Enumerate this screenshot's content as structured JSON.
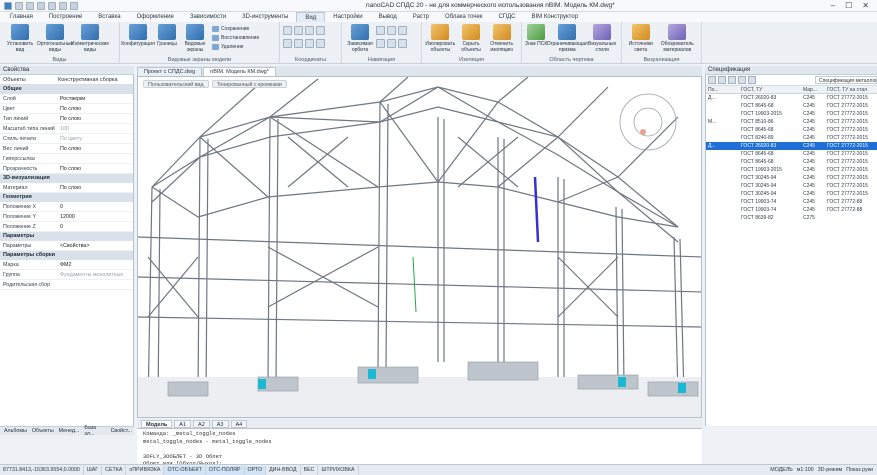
{
  "title": {
    "app": "nanoCAD СПДС 20 - не для коммерческого использования nBIM. Модель КМ.dwg*"
  },
  "tabs": [
    "Главная",
    "Построение",
    "Вставка",
    "Оформление",
    "Зависимости",
    "3D-инструменты",
    "Вид",
    "Настройки",
    "Вывод",
    "Растр",
    "Облака точек",
    "СПДС",
    "BIM Конструктор"
  ],
  "active_tab": "Вид",
  "ribbon": {
    "views": {
      "label": "Виды",
      "b1": "Установить вид",
      "b2": "Ортогональные виды",
      "b3": "Изометрические виды"
    },
    "screens": {
      "label": "Видовые экраны модели",
      "b1": "Конфигурация",
      "b2": "Границы",
      "b3": "Видовые экраны",
      "s1": "Сохранение",
      "s2": "Восстановление",
      "s3": "Удаление"
    },
    "coords": {
      "label": "Координаты"
    },
    "nav": {
      "label": "Навигация",
      "b1": "Зависимая орбита"
    },
    "iso": {
      "label": "Изоляция",
      "b1": "Изолировать объекты",
      "b2": "Скрыть объекты",
      "b3": "Отменить изоляцию"
    },
    "area": {
      "label": "Область чертежа",
      "b1": "Знак ПСК",
      "b2": "Ограничивающая призма",
      "b3": "Визуальные стили"
    },
    "vis": {
      "label": "Визуализация",
      "b1": "Источники света",
      "b2": "Обозреватель материалов"
    }
  },
  "props": {
    "title": "Свойства",
    "top_k": "Объекты",
    "top_v": "Конструктивная сборка",
    "sections": [
      {
        "name": "Общие",
        "rows": [
          [
            "Слой",
            "Ростверки",
            false
          ],
          [
            "Цвет",
            "По слою",
            false
          ],
          [
            "Тип линий",
            "По слою",
            false
          ],
          [
            "Масштаб типа линий",
            "100",
            true
          ],
          [
            "Стиль печати",
            "По цвету",
            true
          ],
          [
            "Вес линий",
            "По слою",
            false
          ],
          [
            "Гиперссылка",
            "",
            false
          ],
          [
            "Прозрачность",
            "По слою",
            false
          ]
        ]
      },
      {
        "name": "3D-визуализация",
        "rows": [
          [
            "Материал",
            "По слою",
            false
          ]
        ]
      },
      {
        "name": "Геометрия",
        "rows": [
          [
            "Положение X",
            "0",
            false
          ],
          [
            "Положение Y",
            "12000",
            false
          ],
          [
            "Положение Z",
            "0",
            false
          ]
        ]
      },
      {
        "name": "Параметры",
        "rows": [
          [
            "Параметры",
            "<Свойства>",
            false
          ]
        ]
      },
      {
        "name": "Параметры сборки",
        "rows": [
          [
            "Марка",
            "ФМ2",
            false
          ],
          [
            "Группа",
            "Фундаменты монолитные",
            true
          ],
          [
            "Родительская сбор",
            "",
            false
          ]
        ]
      }
    ]
  },
  "doc_tabs": [
    "Проект с СПДС.dwg",
    "nBIM. Модель КМ.dwg*"
  ],
  "view_tabs": [
    "Пользовательский вид",
    "Тонированный с кромками"
  ],
  "layout_tabs": [
    "Модель",
    "A1",
    "A2",
    "A3",
    "A4"
  ],
  "spec": {
    "title": "Спецификация",
    "dropdown": "Спецификация металлопроката",
    "headers": [
      "По...",
      "ГОСТ, ТУ",
      "Мар...",
      "ГОСТ, ТУ на стал"
    ],
    "rows": [
      [
        "Д...",
        "ГОСТ 26020-83",
        "С245",
        "ГОСТ 27772-2015",
        false
      ],
      [
        "",
        "ГОСТ 8645-68",
        "С245",
        "ГОСТ 27772-2015",
        false
      ],
      [
        "",
        "ГОСТ 19903-2015",
        "С245",
        "ГОСТ 27772-2015",
        false
      ],
      [
        "М...",
        "ГОСТ 8510-86",
        "С245",
        "ГОСТ 27772-2015",
        false
      ],
      [
        "",
        "ГОСТ 8645-68",
        "С245",
        "ГОСТ 27772-2015",
        false
      ],
      [
        "",
        "ГОСТ 8240-89",
        "С245",
        "ГОСТ 27772-2015",
        false
      ],
      [
        "Д...",
        "ГОСТ 26020-83",
        "С245",
        "ГОСТ 27772-2015",
        true
      ],
      [
        "",
        "ГОСТ 8645-68",
        "С245",
        "ГОСТ 27772-2015",
        false
      ],
      [
        "",
        "ГОСТ 8645-68",
        "С245",
        "ГОСТ 27772-2015",
        false
      ],
      [
        "",
        "ГОСТ 19903-2015",
        "С245",
        "ГОСТ 27772-2015",
        false
      ],
      [
        "",
        "ГОСТ 30245-94",
        "С245",
        "ГОСТ 27772-2015",
        false
      ],
      [
        "",
        "ГОСТ 30245-94",
        "С245",
        "ГОСТ 27772-2015",
        false
      ],
      [
        "",
        "ГОСТ 30245-94",
        "С245",
        "ГОСТ 27772-2015",
        false
      ],
      [
        "",
        "ГОСТ 19903-74",
        "С245",
        "ГОСТ 27772-88",
        false
      ],
      [
        "",
        "ГОСТ 19903-74",
        "С245",
        "ГОСТ 27772-88",
        false
      ],
      [
        "",
        "ГОСТ 8639-82",
        "С275",
        "",
        false
      ]
    ]
  },
  "cmd": [
    "Команда: _metal_toggle_nodes",
    "metal_toggle_nodes - metal_toggle_nodes",
    "",
    "3DFLY_3DOБЛЕТ - 3D Облет",
    "Облет или [Обход/Выход]:"
  ],
  "left_tabs": [
    "Альбомы",
    "Объекты",
    "Менед...",
    "База эл...",
    "Свойст..."
  ],
  "status": {
    "coords": "87731.8413,-15363.9554,0.0000",
    "toggles": [
      "ШАГ",
      "СЕТКА",
      "оПРИВЯЗКА",
      "ОТС-ОБЪЕКТ",
      "ОТС-ПОЛЯР",
      "ОРТО",
      "ДИН-ВВОД",
      "ВЕС",
      "ШТРИХОВКА"
    ],
    "on": [
      false,
      false,
      false,
      true,
      true,
      true,
      false,
      false,
      false
    ],
    "model": "МОДЕЛЬ",
    "scale": "м1:100",
    "mode": "3D-режим",
    "view": "Показ руки"
  }
}
